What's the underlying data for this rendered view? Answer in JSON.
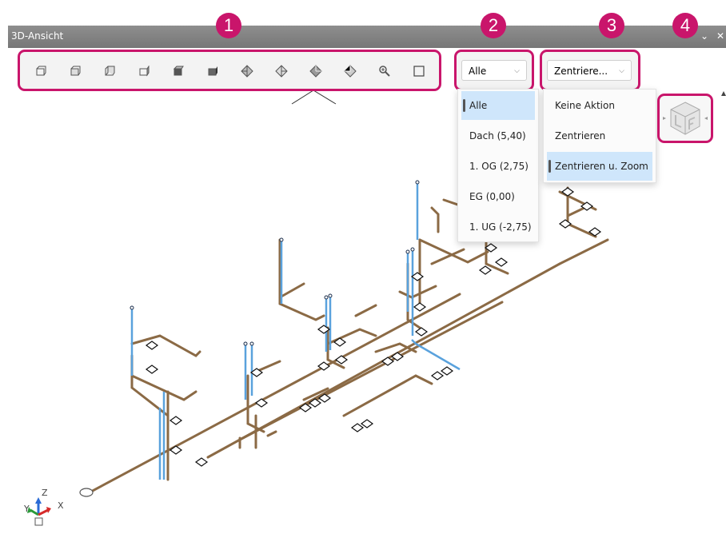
{
  "window": {
    "title": "3D-Ansicht"
  },
  "toolbar": {
    "buttons": [
      {
        "name": "view-front-icon"
      },
      {
        "name": "view-back-icon"
      },
      {
        "name": "view-left-icon"
      },
      {
        "name": "view-right-icon"
      },
      {
        "name": "view-top-icon"
      },
      {
        "name": "view-bottom-icon"
      },
      {
        "name": "iso-sw-icon"
      },
      {
        "name": "iso-se-icon"
      },
      {
        "name": "iso-ne-icon"
      },
      {
        "name": "iso-nw-icon"
      },
      {
        "name": "zoom-icon"
      },
      {
        "name": "frame-icon"
      }
    ]
  },
  "floor_select": {
    "value": "Alle",
    "options": [
      "Alle",
      "Dach (5,40)",
      "1. OG (2,75)",
      "EG (0,00)",
      "1. UG (-2,75)"
    ]
  },
  "action_select": {
    "value": "Zentriere...",
    "options": [
      "Keine Aktion",
      "Zentrieren",
      "Zentrieren u. Zoom"
    ]
  },
  "callouts": [
    "1",
    "2",
    "3",
    "4"
  ],
  "axis": {
    "z": "Z",
    "y": "Y",
    "x": "X"
  },
  "colors": {
    "accent": "#c9156b",
    "pipe": "#8b6a45",
    "riser": "#5aa2dd",
    "selection": "#cfe6fb"
  }
}
